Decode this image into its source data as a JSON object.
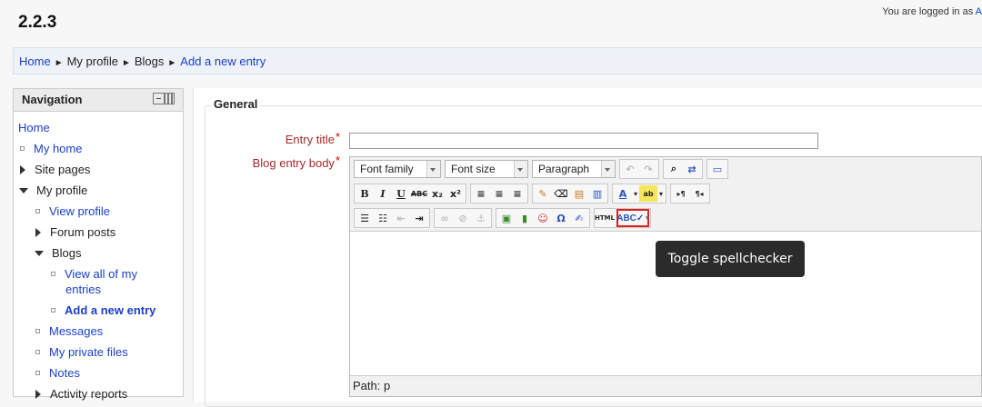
{
  "header": {
    "site_title": "2.2.3",
    "login_text": "You are logged in as",
    "login_link": "A"
  },
  "breadcrumb": [
    {
      "label": "Home",
      "link": true
    },
    {
      "label": "My profile",
      "link": false
    },
    {
      "label": "Blogs",
      "link": false
    },
    {
      "label": "Add a new entry",
      "link": true
    }
  ],
  "breadcrumb_separator": "►",
  "navigation": {
    "title": "Navigation",
    "items": [
      {
        "label": "Home",
        "type": "link"
      },
      {
        "label": "My home",
        "type": "link"
      },
      {
        "label": "Site pages",
        "type": "text"
      },
      {
        "label": "My profile",
        "type": "text"
      },
      {
        "label": "View profile",
        "type": "link"
      },
      {
        "label": "Forum posts",
        "type": "text"
      },
      {
        "label": "Blogs",
        "type": "text"
      },
      {
        "label": "View all of my",
        "type": "link"
      },
      {
        "label": "entries",
        "type": "link"
      },
      {
        "label": "Add a new entry",
        "type": "link",
        "bold": true
      },
      {
        "label": "Messages",
        "type": "link"
      },
      {
        "label": "My private files",
        "type": "link"
      },
      {
        "label": "Notes",
        "type": "link"
      },
      {
        "label": "Activity reports",
        "type": "text"
      }
    ]
  },
  "form": {
    "legend": "General",
    "entry_title_label": "Entry title",
    "entry_title_value": "",
    "body_label": "Blog entry body",
    "required_mark": "*"
  },
  "editor": {
    "font_family": "Font family",
    "font_size": "Font size",
    "format": "Paragraph",
    "path": "Path: p",
    "tooltip": "Toggle spellchecker",
    "icons": {
      "undo": "↶",
      "redo": "↷",
      "find": "⌕",
      "replace": "⇄",
      "fullscreen": "▭",
      "bold": "B",
      "italic": "I",
      "underline": "U",
      "strike": "ABC",
      "sub": "x₂",
      "sup": "x²",
      "align_left": "≡",
      "align_center": "≡",
      "align_right": "≡",
      "cleanup": "✎",
      "eraser": "⌫",
      "paste_text": "▤",
      "paste_word": "▥",
      "text_color": "A",
      "highlight": "ab",
      "ltr": "▸¶",
      "rtl": "¶◂",
      "bullet_list": "☰",
      "num_list": "☷",
      "outdent": "⇤",
      "indent": "⇥",
      "link": "∞",
      "unlink": "⊘",
      "anchor": "⚓",
      "image": "▣",
      "media": "▮",
      "emoticon": "☺",
      "charmap": "Ω",
      "edit": "✍",
      "html": "HTML",
      "spell": "ABC✓",
      "dropdown_arrow": "▾"
    }
  }
}
